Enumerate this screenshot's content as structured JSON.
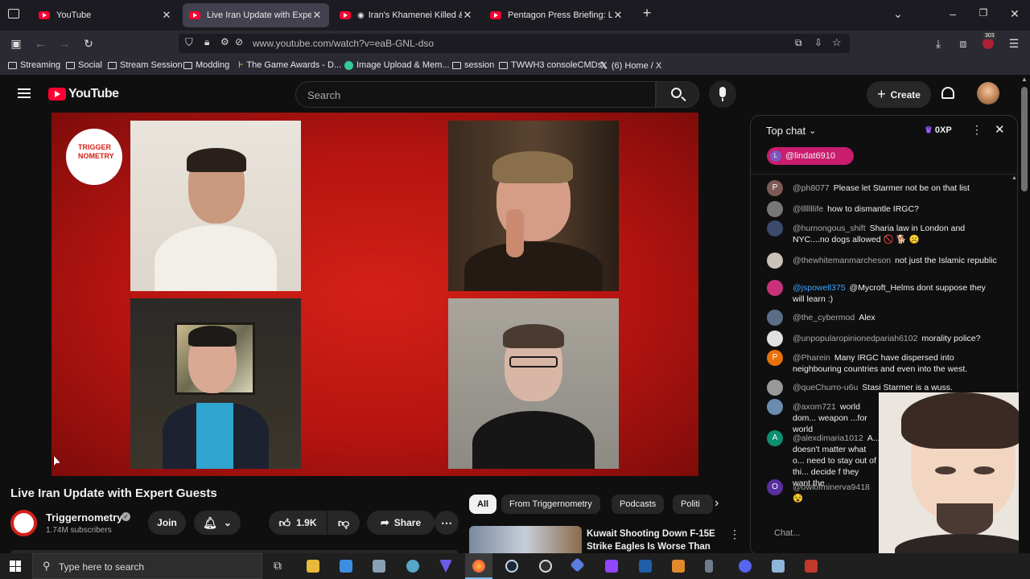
{
  "browser": {
    "tabs": [
      {
        "label": "YouTube"
      },
      {
        "label": "Live Iran Update with Expert Gu"
      },
      {
        "label": "Iran's Khamenei Killed & Au"
      },
      {
        "label": "Pentagon Press Briefing: Live Up"
      }
    ],
    "url": "www.youtube.com/watch?v=eaB-GNL-dso",
    "extension_badge": "303",
    "bookmarks": [
      "Streaming",
      "Social",
      "Stream Session",
      "Modding",
      "The Game Awards - D...",
      "Image Upload & Mem...",
      "session",
      "TWWH3 consoleCMDs",
      "(6) Home / X"
    ]
  },
  "youtube": {
    "logo_text": "YouTube",
    "search_placeholder": "Search",
    "create_label": "Create"
  },
  "video": {
    "brand_text": "TRIGGER NOMETRY",
    "title": "Live Iran Update with Expert Guests",
    "channel": "Triggernometry",
    "subscribers": "1.74M subscribers",
    "join_label": "Join",
    "likes": "1.9K",
    "share_label": "Share"
  },
  "chips": [
    "All",
    "From Triggernometry",
    "Podcasts",
    "Politi"
  ],
  "recommendation": {
    "title_line1": "Kuwait Shooting Down F-15E",
    "title_line2": "Strike Eagles Is Worse Than Y..."
  },
  "chat": {
    "mode_label": "Top chat",
    "xp_label": "0XP",
    "pinned_user": "@lindat6910",
    "input_placeholder": "Chat...",
    "messages": [
      {
        "author": "@ph8077",
        "text": "Please let Starmer not be on that list",
        "avatar": "P",
        "color": "#7d5a55"
      },
      {
        "author": "@lllllllife",
        "text": "how to dismantle IRGC?",
        "avatar": "",
        "color": "#777777"
      },
      {
        "author": "@humongous_shift",
        "text": "Sharia law in London and NYC....no dogs allowed 🚫 🐕 ☹️",
        "avatar": "",
        "color": "#3b4a6b"
      },
      {
        "author": "@thewhitemanmarcheson",
        "text": "not just the Islamic republic",
        "avatar": "",
        "color": "#c8c2b8"
      },
      {
        "author": "@jspowell375",
        "text": "@Mycroft_Helms dont suppose they will learn :)",
        "avatar": "",
        "color": "#c9327a",
        "blue": true
      },
      {
        "author": "@the_cybermod",
        "text": "Alex",
        "avatar": "",
        "color": "#5a6e86"
      },
      {
        "author": "@unpopularopinionedpariah6102",
        "text": "morality police?",
        "avatar": "",
        "color": "#e0e0e0"
      },
      {
        "author": "@Pharein",
        "text": "Many IRGC have dispersed into neighbouring countries and even into the west.",
        "avatar": "P",
        "color": "#e8710a"
      },
      {
        "author": "@queChurro-u6u",
        "text": "Stasi Starmer is a wuss.",
        "avatar": "",
        "color": "#999999"
      },
      {
        "author": "@axom721",
        "text": "world dom... weapon ...for world",
        "avatar": "",
        "color": "#6a8caf"
      },
      {
        "author": "@alexdimaria1012",
        "text": "A... doesn't matter what o... need to stay out of thi... decide f they want the",
        "avatar": "A",
        "color": "#0b8f6e"
      },
      {
        "author": "@owlofminerva9418",
        "text": "😵",
        "avatar": "O",
        "color": "#5a2fa0"
      }
    ]
  },
  "taskbar": {
    "search_placeholder": "Type here to search"
  }
}
